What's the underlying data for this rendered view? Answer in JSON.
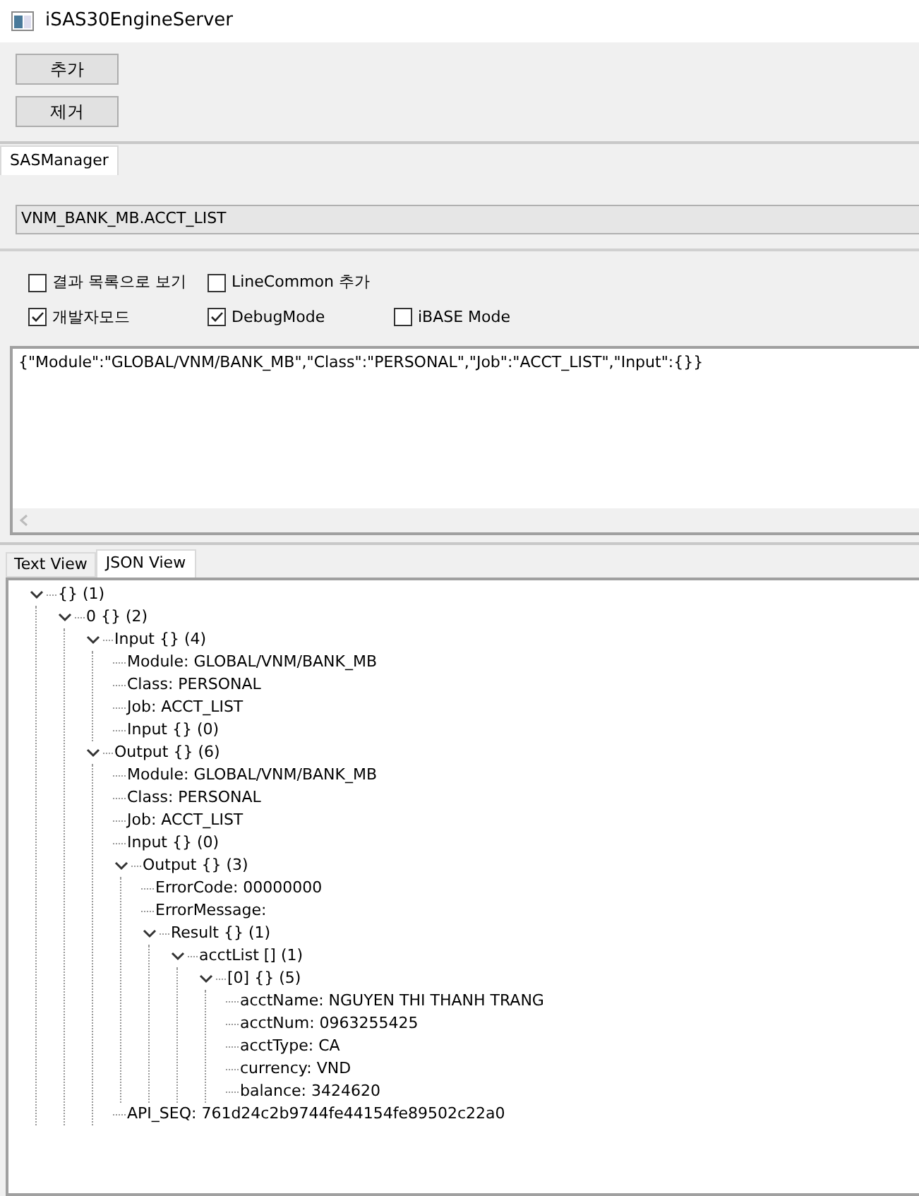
{
  "window": {
    "title": "iSAS30EngineServer"
  },
  "buttons": [
    "추가",
    "제거"
  ],
  "main_tabs": [
    {
      "label": "SASManager",
      "selected": true
    }
  ],
  "job_field": {
    "value": "VNM_BANK_MB.ACCT_LIST"
  },
  "options": [
    {
      "items": [
        {
          "label": "결과 목록으로 보기",
          "checked": false
        },
        {
          "label": "LineCommon 추가",
          "checked": false
        }
      ]
    },
    {
      "items": [
        {
          "label": "개발자모드",
          "checked": true
        },
        {
          "label": "DebugMode",
          "checked": true
        },
        {
          "label": "iBASE Mode",
          "checked": false
        }
      ]
    }
  ],
  "request": {
    "value": "{\"Module\":\"GLOBAL/VNM/BANK_MB\",\"Class\":\"PERSONAL\",\"Job\":\"ACCT_LIST\",\"Input\":{}}"
  },
  "view_tabs": [
    {
      "label": "Text View",
      "selected": false
    },
    {
      "label": "JSON View",
      "selected": true
    }
  ],
  "tree": [
    {
      "label": "{} (1)",
      "expanded": true,
      "children": [
        {
          "label": "0 {} (2)",
          "expanded": true,
          "children": [
            {
              "label": "Input {} (4)",
              "expanded": true,
              "children": [
                {
                  "label": "Module: GLOBAL/VNM/BANK_MB"
                },
                {
                  "label": "Class: PERSONAL"
                },
                {
                  "label": "Job: ACCT_LIST"
                },
                {
                  "label": "Input {} (0)"
                }
              ]
            },
            {
              "label": "Output {} (6)",
              "expanded": true,
              "children": [
                {
                  "label": "Module: GLOBAL/VNM/BANK_MB"
                },
                {
                  "label": "Class: PERSONAL"
                },
                {
                  "label": "Job: ACCT_LIST"
                },
                {
                  "label": "Input {} (0)"
                },
                {
                  "label": "Output {} (3)",
                  "expanded": true,
                  "children": [
                    {
                      "label": "ErrorCode: 00000000"
                    },
                    {
                      "label": "ErrorMessage:"
                    },
                    {
                      "label": "Result {} (1)",
                      "expanded": true,
                      "children": [
                        {
                          "label": "acctList [] (1)",
                          "expanded": true,
                          "children": [
                            {
                              "label": "[0] {} (5)",
                              "expanded": true,
                              "children": [
                                {
                                  "label": "acctName: NGUYEN THI THANH TRANG"
                                },
                                {
                                  "label": "acctNum: 0963255425"
                                },
                                {
                                  "label": "acctType: CA"
                                },
                                {
                                  "label": "currency: VND"
                                },
                                {
                                  "label": "balance: 3424620"
                                }
                              ]
                            }
                          ]
                        }
                      ]
                    }
                  ]
                },
                {
                  "label": "API_SEQ: 761d24c2b9744fe44154fe89502c22a0"
                }
              ]
            }
          ]
        }
      ]
    }
  ]
}
